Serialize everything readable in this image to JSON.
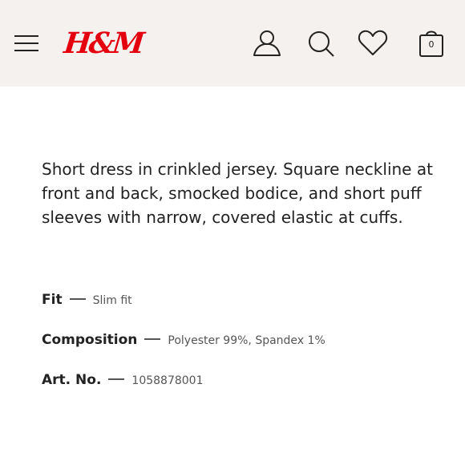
{
  "header": {
    "brand": "H&M",
    "cart_count": "0",
    "colors": {
      "background": "#f4f1ee",
      "brand": "#e50010"
    },
    "icons": [
      "menu-icon",
      "account-icon",
      "search-icon",
      "heart-icon",
      "shopping-bag-icon"
    ]
  },
  "product": {
    "description": "Short dress in crinkled jersey. Square neckline at front and back, smocked bodice, and short puff sleeves with narrow, covered elastic at cuffs.",
    "specs": [
      {
        "label": "Fit",
        "value": "Slim fit"
      },
      {
        "label": "Composition",
        "value": "Polyester 99%, Spandex 1%"
      },
      {
        "label": "Art. No.",
        "value": "1058878001"
      }
    ]
  }
}
